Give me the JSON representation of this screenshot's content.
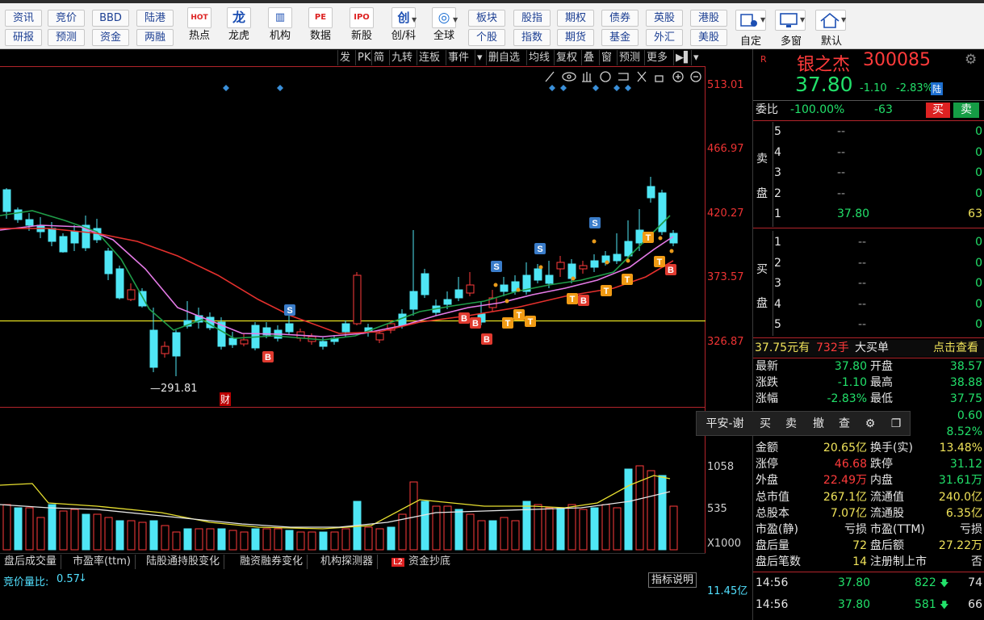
{
  "toolbar": {
    "row1": [
      "资讯",
      "竞价",
      "BBD",
      "陆港"
    ],
    "row2": [
      "研报",
      "预测",
      "资金",
      "两融"
    ],
    "icons": [
      {
        "label": "热点",
        "glyph": "HOT",
        "icon": "hot-icon"
      },
      {
        "label": "龙虎",
        "glyph": "龙",
        "icon": "dragon-tiger-icon"
      },
      {
        "label": "机构",
        "glyph": "▥",
        "icon": "institution-icon"
      },
      {
        "label": "数据",
        "glyph": "PE",
        "icon": "data-icon"
      },
      {
        "label": "新股",
        "glyph": "IPO",
        "icon": "ipo-icon"
      },
      {
        "label": "创/科",
        "glyph": "创",
        "icon": "chuang-icon"
      },
      {
        "label": "全球",
        "glyph": "◎",
        "icon": "globe-icon"
      }
    ],
    "mkt_row1": [
      "板块",
      "股指",
      "期权",
      "债券",
      "英股",
      "港股"
    ],
    "mkt_row2": [
      "个股",
      "指数",
      "期货",
      "基金",
      "外汇",
      "美股"
    ],
    "right": [
      "自定",
      "多窗",
      "默认"
    ]
  },
  "chart_tools": [
    "发",
    "PK",
    "简",
    "九转",
    "连板",
    "事件",
    "▾",
    "删自选",
    "均线",
    "复权",
    "叠",
    "窗",
    "预测",
    "更多",
    "▶▌",
    "▾"
  ],
  "price_axis": [
    "513.01",
    "466.97",
    "420.27",
    "373.57",
    "326.87"
  ],
  "low_label": "291.81",
  "cai_mark": "财",
  "volume_axis": [
    "1058",
    "535",
    "X1000"
  ],
  "indicator_tabs": [
    "盘后成交量",
    "市盈率(ttm)",
    "陆股通持股变化",
    "融资融券变化",
    "机构探测器",
    "L2",
    "资金抄底"
  ],
  "bid_ratio": {
    "label": "竞价量比:",
    "value": "0.57"
  },
  "indicator_desc": "指标说明",
  "amount_label": "11.45亿",
  "float_toolbar": [
    "平安-谢",
    "买",
    "卖",
    "撤",
    "查",
    "⚙",
    "❐"
  ],
  "quote": {
    "r_mark": "R",
    "name": "银之杰",
    "code": "300085",
    "price": "37.80",
    "change": "-1.10",
    "change_pct": "-2.83%",
    "lu": "陆",
    "webi_label": "委比",
    "webi_value": "-100.00%",
    "webi_diff": "-63",
    "buy_btn": "买",
    "sell_btn": "卖",
    "sell_side_label": [
      "卖",
      "盘"
    ],
    "buy_side_label": [
      "买",
      "盘"
    ],
    "asks": [
      {
        "level": "5",
        "price": "--",
        "vol": "0"
      },
      {
        "level": "4",
        "price": "--",
        "vol": "0"
      },
      {
        "level": "3",
        "price": "--",
        "vol": "0"
      },
      {
        "level": "2",
        "price": "--",
        "vol": "0"
      },
      {
        "level": "1",
        "price": "37.80",
        "vol": "63"
      }
    ],
    "bids": [
      {
        "level": "1",
        "price": "--",
        "vol": "0"
      },
      {
        "level": "2",
        "price": "--",
        "vol": "0"
      },
      {
        "level": "3",
        "price": "--",
        "vol": "0"
      },
      {
        "level": "4",
        "price": "--",
        "vol": "0"
      },
      {
        "level": "5",
        "price": "--",
        "vol": "0"
      }
    ],
    "big_order": {
      "price": "37.75元有",
      "vol": "732手",
      "type": "大买单",
      "action": "点击查看"
    },
    "stats": [
      {
        "l1": "最新",
        "v1": "37.80",
        "c1": "green",
        "l2": "开盘",
        "v2": "38.57",
        "c2": "green"
      },
      {
        "l1": "涨跌",
        "v1": "-1.10",
        "c1": "green",
        "l2": "最高",
        "v2": "38.88",
        "c2": "green"
      },
      {
        "l1": "涨幅",
        "v1": "-2.83%",
        "c1": "green",
        "l2": "最低",
        "v2": "37.75",
        "c2": "green"
      },
      {
        "l1": "",
        "v1": "",
        "c1": "white",
        "l2": "",
        "v2": "0.60",
        "c2": "green"
      },
      {
        "l1": "",
        "v1": "",
        "c1": "white",
        "l2": "",
        "v2": "8.52%",
        "c2": "green"
      },
      {
        "l1": "金额",
        "v1": "20.65亿",
        "c1": "yellow",
        "l2": "换手(实)",
        "v2": "13.48%",
        "c2": "yellow"
      },
      {
        "l1": "涨停",
        "v1": "46.68",
        "c1": "red",
        "l2": "跌停",
        "v2": "31.12",
        "c2": "green"
      },
      {
        "l1": "外盘",
        "v1": "22.49万",
        "c1": "red",
        "l2": "内盘",
        "v2": "31.61万",
        "c2": "green"
      },
      {
        "l1": "总市值",
        "v1": "267.1亿",
        "c1": "yellow",
        "l2": "流通值",
        "v2": "240.0亿",
        "c2": "yellow"
      },
      {
        "l1": "总股本",
        "v1": "7.07亿",
        "c1": "yellow",
        "l2": "流通股",
        "v2": "6.35亿",
        "c2": "yellow"
      },
      {
        "l1": "市盈(静)",
        "v1": "亏损",
        "c1": "white",
        "l2": "市盈(TTM)",
        "v2": "亏损",
        "c2": "white"
      },
      {
        "l1": "盘后量",
        "v1": "72",
        "c1": "yellow",
        "l2": "盘后额",
        "v2": "27.22万",
        "c2": "yellow"
      },
      {
        "l1": "盘后笔数",
        "v1": "14",
        "c1": "yellow",
        "l2": "注册制上市",
        "v2": "否",
        "c2": "white"
      }
    ],
    "ticks": [
      {
        "time": "14:56",
        "price": "37.80",
        "vol": "822",
        "count": "74"
      },
      {
        "time": "14:56",
        "price": "37.80",
        "vol": "581",
        "count": "66"
      }
    ]
  },
  "colors": {
    "up": "#ff3b3b",
    "down": "#4fe6f5",
    "ma5": "#1f9b48",
    "ma10": "#e67be8",
    "ma20": "#e4302d",
    "base_line": "#e5e020",
    "bg": "#000000"
  }
}
